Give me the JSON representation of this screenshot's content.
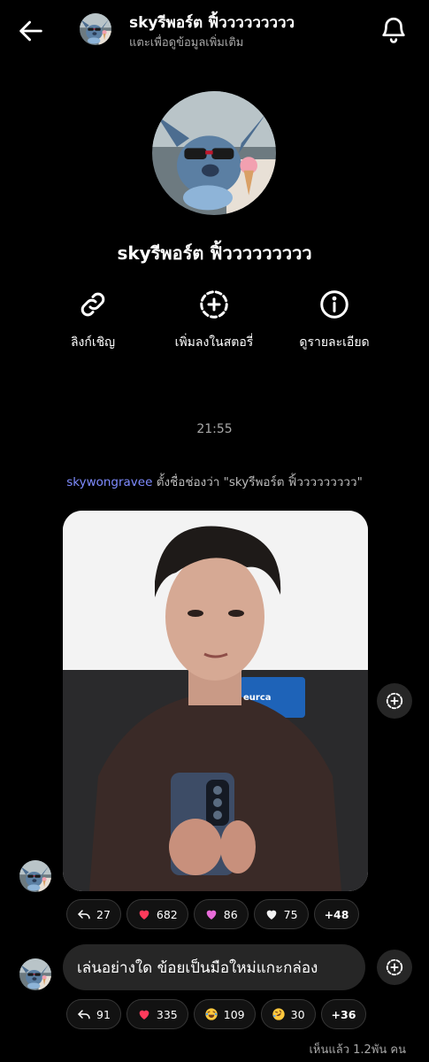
{
  "header": {
    "back_icon": "arrow-left-icon",
    "title": "skyรีพอร์ต ฟิ้ววววววววว",
    "subtitle": "แตะเพื่อดูข้อมูลเพิ่มเติม",
    "bell_icon": "bell-icon"
  },
  "profile": {
    "name": "skyรีพอร์ต ฟิ้ววววววววว"
  },
  "actions": [
    {
      "label": "ลิงก์เชิญ",
      "icon": "link-icon"
    },
    {
      "label": "เพิ่มลงในสตอรี่",
      "icon": "add-story-icon"
    },
    {
      "label": "ดูรายละเอียด",
      "icon": "info-icon"
    }
  ],
  "chat": {
    "time": "21:55",
    "system_message": {
      "user": "skywongravee",
      "text": " ตั้งชื่อช่องว่า \"skyรีพอร์ต ฟิ้ววววววววว\""
    },
    "message1": {
      "photo_badge_text": "eurca",
      "reactions": [
        {
          "icon": "reply-icon",
          "count": "27"
        },
        {
          "icon": "red-heart-icon",
          "count": "682"
        },
        {
          "icon": "pink-heart-icon",
          "count": "86"
        },
        {
          "icon": "white-heart-icon",
          "count": "75"
        },
        {
          "icon": "",
          "count": "+48"
        }
      ]
    },
    "message2": {
      "text": "เล่นอย่างใด ข้อยเป็นมือใหม่แกะกล่อง",
      "reactions": [
        {
          "icon": "reply-icon",
          "count": "91"
        },
        {
          "icon": "red-heart-icon",
          "count": "335"
        },
        {
          "icon": "joy-emoji-icon",
          "count": "109"
        },
        {
          "icon": "rofl-emoji-icon",
          "count": "30"
        },
        {
          "icon": "",
          "count": "+36"
        }
      ]
    },
    "seen_text": "เห็นแล้ว 1.2พัน คน"
  },
  "colors": {
    "background": "#000000",
    "bubble": "#262626",
    "link_user": "#7f8cff",
    "secondary_text": "#a8a8a8",
    "red_heart": "#ff3b5c",
    "pink_heart": "#e86bd9"
  }
}
